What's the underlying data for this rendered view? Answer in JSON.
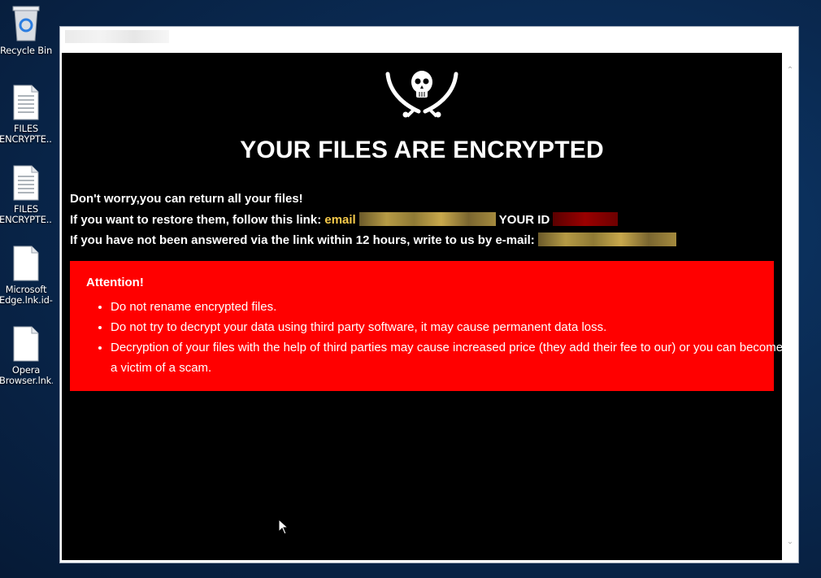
{
  "desktop": {
    "icons": [
      {
        "label": "Recycle Bin",
        "type": "recycle-bin"
      },
      {
        "label": "FILES\nENCRYPTE...",
        "type": "text-file"
      },
      {
        "label": "FILES\nENCRYPTE...",
        "type": "text-file"
      },
      {
        "label": "Microsoft\nEdge.lnk.id-...",
        "type": "blank-file"
      },
      {
        "label": "Opera\nBrowser.lnk....",
        "type": "blank-file"
      }
    ]
  },
  "window": {
    "heading": "YOUR FILES ARE ENCRYPTED",
    "line1": "Don't worry,you can return all your files!",
    "line2_prefix": "If you want to restore them, follow this link:",
    "line2_email_word": "email",
    "line2_id_label": "YOUR ID",
    "line3": "If you have not been answered via the link within 12 hours, write to us by e-mail:",
    "attention": {
      "title": "Attention!",
      "items": [
        "Do not rename encrypted files.",
        "Do not try to decrypt your data using third party software, it may cause permanent data loss.",
        "Decryption of your files with the help of third parties may cause increased price (they add their fee to our) or you can become a victim of a scam."
      ]
    }
  },
  "colors": {
    "content_bg": "#000000",
    "attention_bg": "#ff0000",
    "email_accent": "#f5c94a"
  }
}
